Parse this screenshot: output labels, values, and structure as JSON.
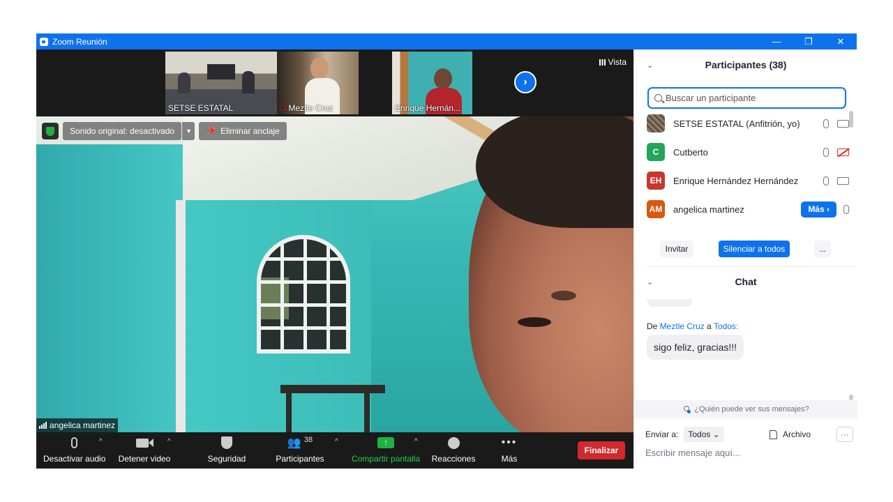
{
  "window": {
    "title": "Zoom Reunión",
    "controls": [
      "—",
      "❐",
      "✕"
    ]
  },
  "thumbnails": [
    {
      "name": "SETSE ESTATAL",
      "muted": false
    },
    {
      "name": "Meztle Cruz",
      "muted": true
    },
    {
      "name": "Enrique Hernán..."
    }
  ],
  "view_label": "Vista",
  "main_video": {
    "speaker": "angelica martinez",
    "original_sound": "Sonido original: desactivado",
    "unpin": "Eliminar anclaje"
  },
  "toolbar": {
    "mute": "Desactivar audio",
    "video": "Detener video",
    "security": "Seguridad",
    "participants": "Participantes",
    "participants_count": "38",
    "share": "Compartir pantalla",
    "reactions": "Reacciones",
    "more": "Más",
    "end": "Finalizar"
  },
  "participants_panel": {
    "title": "Participantes (38)",
    "search_placeholder": "Buscar un participante",
    "items": [
      {
        "name": "SETSE ESTATAL (Anfitrión, yo)",
        "initials": "",
        "color": "#6b5b4b",
        "video_off": false
      },
      {
        "name": "Cutberto",
        "initials": "C",
        "color": "#23a55a",
        "video_off": true
      },
      {
        "name": "Enrique Hernández Hernández",
        "initials": "EH",
        "color": "#c8372d",
        "video_off": false
      },
      {
        "name": "angelica martinez",
        "initials": "AM",
        "color": "#d9570f",
        "more_label": "Más"
      }
    ],
    "invite": "Invitar",
    "mute_all": "Silenciar a todos",
    "more": "..."
  },
  "chat_panel": {
    "title": "Chat",
    "from_prefix": "De",
    "from_name": "Meztle Cruz",
    "to_word": "a",
    "to_name": "Todos:",
    "message": "sigo feliz, gracias!!!",
    "who_can_see": "¿Quién puede ver sus mensajes?",
    "send_to_label": "Enviar a:",
    "send_to_value": "Todos",
    "file_label": "Archivo",
    "more": "···",
    "input_placeholder": "Escribir mensaje aquí..."
  }
}
